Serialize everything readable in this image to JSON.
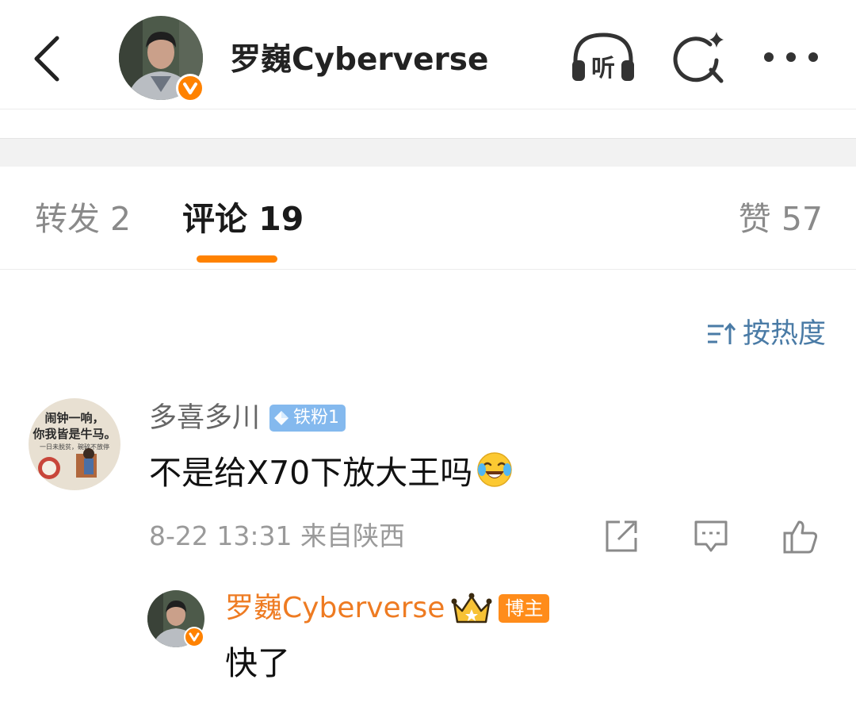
{
  "header": {
    "title": "罗巍Cyberverse",
    "back_icon": "chevron-left-icon",
    "listen_icon": "headphones-listen-icon",
    "listen_label": "听",
    "search_icon": "search-sparkle-icon",
    "more_icon": "more-dots-icon",
    "verified_color": "#ff8200"
  },
  "tabs": {
    "repost": "转发 2",
    "comment": "评论 19",
    "like": "赞 57",
    "active": "comment",
    "indicator_color": "#ff8200"
  },
  "sort": {
    "label": "按热度",
    "icon": "sort-hot-icon",
    "color": "#4a7ba6"
  },
  "comments": [
    {
      "author": "多喜多川",
      "badge": "铁粉1",
      "badge_icon": "diamond-icon",
      "text": "不是给X70下放大王吗",
      "emoji": "laugh-cry-emoji",
      "timestamp": "8-22 13:31",
      "location": "来自陕西",
      "avatar_text_line1": "闹钟一响，",
      "avatar_text_line2": "你我皆是牛马。",
      "avatar_text_line3": "一日未脱贫，碗碎不放停",
      "actions": [
        "share-icon",
        "reply-comment-icon",
        "thumbs-up-icon"
      ],
      "replies": [
        {
          "author": "罗巍Cyberverse",
          "badge": "博主",
          "badge_icon": "crown-icon",
          "text": "快了",
          "author_color": "#ee7b22"
        }
      ]
    }
  ]
}
